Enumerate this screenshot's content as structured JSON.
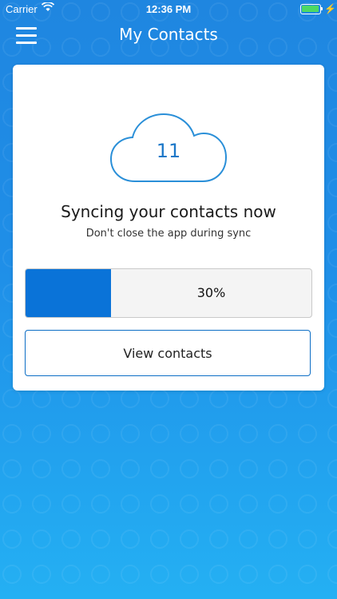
{
  "status_bar": {
    "carrier": "Carrier",
    "time": "12:36 PM",
    "wifi_icon": "wifi-icon",
    "battery_icon": "battery-icon"
  },
  "nav": {
    "title": "My Contacts",
    "menu_icon": "hamburger-menu-icon"
  },
  "sync_card": {
    "cloud_icon": "cloud-icon",
    "count": "11",
    "heading": "Syncing your contacts now",
    "subtext": "Don't close the app during sync",
    "progress_label": "30%",
    "progress_fraction": 0.3,
    "view_button_label": "View contacts"
  },
  "colors": {
    "accent": "#0a73d8",
    "background_top": "#1f86e0",
    "background_bottom": "#24b0f3",
    "cloud_outline": "#2a8fd8"
  }
}
